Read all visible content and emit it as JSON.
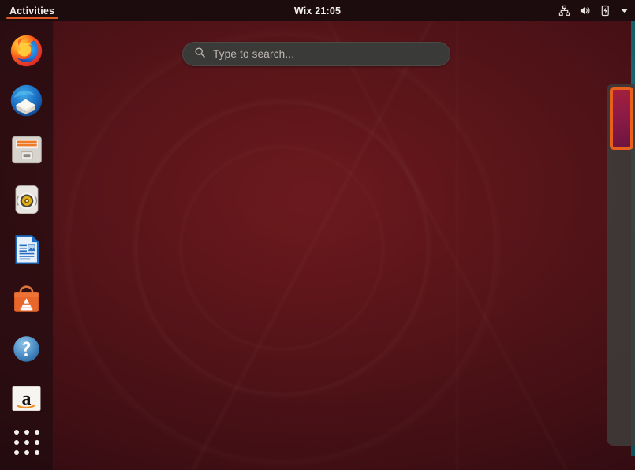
{
  "topbar": {
    "activities_label": "Activities",
    "clock": "Wix 21:05",
    "status_icons": [
      {
        "name": "network-wired-icon",
        "label": "Network"
      },
      {
        "name": "volume-icon",
        "label": "Volume"
      },
      {
        "name": "battery-charging-icon",
        "label": "Battery charging"
      },
      {
        "name": "chevron-down-icon",
        "label": "System menu"
      }
    ]
  },
  "search": {
    "placeholder": "Type to search...",
    "value": "",
    "icon": "search-icon"
  },
  "dock": {
    "items": [
      {
        "name": "firefox",
        "label": "Firefox Web Browser"
      },
      {
        "name": "thunderbird",
        "label": "Thunderbird Mail"
      },
      {
        "name": "files",
        "label": "Files"
      },
      {
        "name": "rhythmbox",
        "label": "Rhythmbox"
      },
      {
        "name": "libreoffice-writer",
        "label": "LibreOffice Writer"
      },
      {
        "name": "ubuntu-software",
        "label": "Ubuntu Software"
      },
      {
        "name": "help",
        "label": "Help"
      },
      {
        "name": "amazon",
        "label": "Amazon"
      }
    ],
    "apps_button_label": "Show Applications"
  },
  "workspaces": {
    "items": [
      {
        "label": "Workspace 1",
        "active": true
      }
    ]
  },
  "colors": {
    "accent_orange": "#e25822",
    "topbar_bg": "#1d0c0e",
    "dock_bg": "rgba(28,12,15,0.62)",
    "search_bg": "#3a3a38",
    "workspace_selected_border": "#e8601c",
    "desktop_base": "#7a1d22"
  }
}
